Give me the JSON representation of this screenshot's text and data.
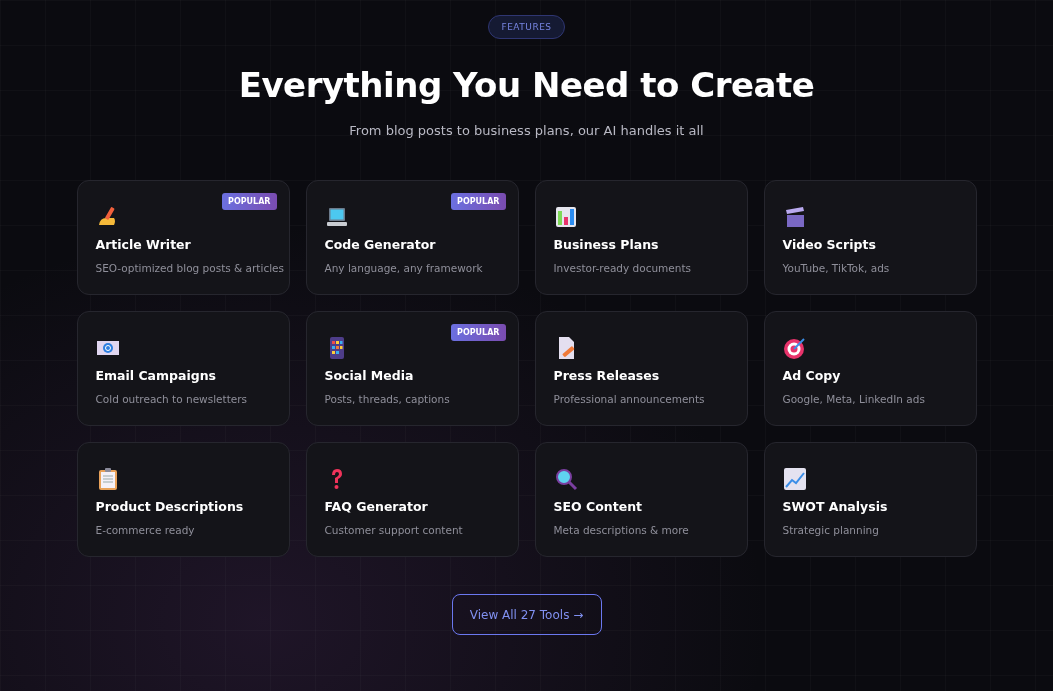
{
  "section_badge": "FEATURES",
  "heading": "Everything You Need to Create",
  "subtitle": "From blog posts to business plans, our AI handles it all",
  "tools": [
    {
      "title": "Article Writer",
      "description": "SEO-optimized blog posts & articles",
      "badge": "POPULAR"
    },
    {
      "title": "Code Generator",
      "description": "Any language, any framework",
      "badge": "POPULAR"
    },
    {
      "title": "Business Plans",
      "description": "Investor-ready documents"
    },
    {
      "title": "Video Scripts",
      "description": "YouTube, TikTok, ads"
    },
    {
      "title": "Email Campaigns",
      "description": "Cold outreach to newsletters"
    },
    {
      "title": "Social Media",
      "description": "Posts, threads, captions",
      "badge": "POPULAR"
    },
    {
      "title": "Press Releases",
      "description": "Professional announcements"
    },
    {
      "title": "Ad Copy",
      "description": "Google, Meta, LinkedIn ads"
    },
    {
      "title": "Product Descriptions",
      "description": "E-commerce ready"
    },
    {
      "title": "FAQ Generator",
      "description": "Customer support content"
    },
    {
      "title": "SEO Content",
      "description": "Meta descriptions & more"
    },
    {
      "title": "SWOT Analysis",
      "description": "Strategic planning"
    }
  ],
  "cta_button": "View All 27 Tools →"
}
